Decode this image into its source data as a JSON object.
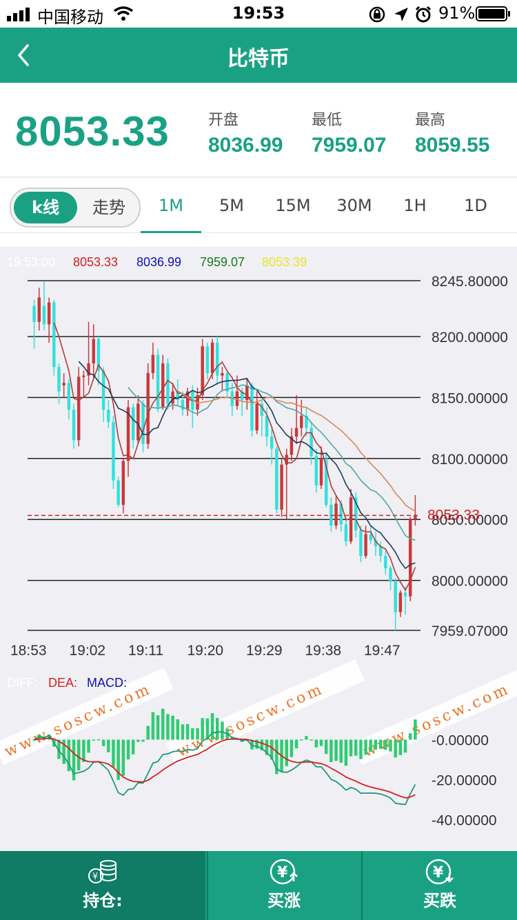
{
  "status_bar": {
    "carrier": "中国移动",
    "time": "19:53",
    "battery": "91%",
    "icons": [
      "signal-icon",
      "wifi-icon",
      "orientation-lock-icon",
      "location-icon",
      "alarm-icon",
      "battery-icon"
    ]
  },
  "nav": {
    "title": "比特币",
    "back_icon": "chevron-left-icon"
  },
  "price": {
    "current": "8053.33",
    "open_label": "开盘",
    "open": "8036.99",
    "low_label": "最低",
    "low": "7959.07",
    "high_label": "最高",
    "high": "8059.55"
  },
  "tabs": {
    "kline": "k线",
    "trend": "走势",
    "periods": [
      "1M",
      "5M",
      "15M",
      "30M",
      "1H",
      "1D"
    ],
    "active_period": "1M"
  },
  "colors": {
    "accent": "#1aa184",
    "up": "#c9393a",
    "down": "#33e0dc",
    "macd_bar": "#2ecc71"
  },
  "chart_data": [
    {
      "type": "candlestick",
      "info_line": {
        "time": "19:53:00",
        "v1": "8053.33",
        "v2": "8036.99",
        "v3": "7959.07",
        "v4": "8053.39"
      },
      "y_labels": [
        "8245.80000",
        "8200.00000",
        "8150.00000",
        "8100.00000",
        "8050.00000",
        "8000.00000",
        "7959.07000"
      ],
      "y_ticks": [
        8245.8,
        8200,
        8150,
        8100,
        8050,
        8000,
        7959.07
      ],
      "ylim": [
        7959.07,
        8245.8
      ],
      "x_labels": [
        "18:53",
        "19:02",
        "19:11",
        "19:20",
        "19:29",
        "19:38",
        "19:47"
      ],
      "current_price_label": "8053.33",
      "current_price": 8053.33,
      "candles": [
        [
          8225,
          8212,
          8230,
          8190
        ],
        [
          8212,
          8232,
          8240,
          8205
        ],
        [
          8225,
          8210,
          8245,
          8205
        ],
        [
          8210,
          8228,
          8232,
          8195
        ],
        [
          8228,
          8175,
          8230,
          8168
        ],
        [
          8175,
          8155,
          8178,
          8145
        ],
        [
          8160,
          8162,
          8170,
          8150
        ],
        [
          8162,
          8140,
          8165,
          8132
        ],
        [
          8140,
          8115,
          8145,
          8108
        ],
        [
          8115,
          8167,
          8175,
          8110
        ],
        [
          8167,
          8168,
          8172,
          8150
        ],
        [
          8168,
          8178,
          8212,
          8160
        ],
        [
          8178,
          8198,
          8210,
          8165
        ],
        [
          8198,
          8172,
          8200,
          8160
        ],
        [
          8172,
          8140,
          8175,
          8130
        ],
        [
          8140,
          8130,
          8148,
          8125
        ],
        [
          8130,
          8082,
          8135,
          8075
        ],
        [
          8082,
          8062,
          8085,
          8060
        ],
        [
          8062,
          8098,
          8100,
          8055
        ],
        [
          8098,
          8142,
          8148,
          8085
        ],
        [
          8142,
          8115,
          8145,
          8108
        ],
        [
          8115,
          8145,
          8152,
          8112
        ],
        [
          8145,
          8112,
          8148,
          8105
        ],
        [
          8112,
          8170,
          8178,
          8108
        ],
        [
          8170,
          8185,
          8195,
          8165
        ],
        [
          8185,
          8142,
          8190,
          8138
        ],
        [
          8142,
          8178,
          8185,
          8140
        ],
        [
          8178,
          8145,
          8182,
          8140
        ],
        [
          8145,
          8155,
          8162,
          8140
        ],
        [
          8155,
          8148,
          8165,
          8143
        ],
        [
          8148,
          8140,
          8155,
          8135
        ],
        [
          8140,
          8155,
          8158,
          8135
        ],
        [
          8155,
          8140,
          8160,
          8125
        ],
        [
          8140,
          8152,
          8158,
          8135
        ],
        [
          8152,
          8192,
          8198,
          8148
        ],
        [
          8192,
          8170,
          8195,
          8165
        ],
        [
          8170,
          8195,
          8198,
          8165
        ],
        [
          8195,
          8168,
          8200,
          8160
        ],
        [
          8168,
          8170,
          8175,
          8155
        ],
        [
          8170,
          8155,
          8172,
          8150
        ],
        [
          8155,
          8143,
          8162,
          8135
        ],
        [
          8143,
          8155,
          8168,
          8140
        ],
        [
          8155,
          8148,
          8158,
          8135
        ],
        [
          8148,
          8160,
          8165,
          8140
        ],
        [
          8160,
          8123,
          8162,
          8118
        ],
        [
          8123,
          8145,
          8155,
          8120
        ],
        [
          8145,
          8135,
          8148,
          8118
        ],
        [
          8135,
          8118,
          8142,
          8110
        ],
        [
          8118,
          8108,
          8125,
          8095
        ],
        [
          8108,
          8058,
          8110,
          8055
        ],
        [
          8058,
          8095,
          8100,
          8052
        ],
        [
          8095,
          8103,
          8108,
          8050
        ],
        [
          8103,
          8118,
          8125,
          8098
        ],
        [
          8118,
          8125,
          8152,
          8112
        ],
        [
          8125,
          8135,
          8148,
          8118
        ],
        [
          8135,
          8125,
          8142,
          8118
        ],
        [
          8125,
          8102,
          8130,
          8095
        ],
        [
          8102,
          8078,
          8108,
          8072
        ],
        [
          8078,
          8100,
          8110,
          8075
        ],
        [
          8100,
          8062,
          8105,
          8060
        ],
        [
          8062,
          8045,
          8068,
          8040
        ],
        [
          8045,
          8063,
          8070,
          8042
        ],
        [
          8063,
          8046,
          8066,
          8040
        ],
        [
          8046,
          8032,
          8052,
          8028
        ],
        [
          8032,
          8068,
          8075,
          8030
        ],
        [
          8068,
          8041,
          8072,
          8035
        ],
        [
          8041,
          8020,
          8045,
          8015
        ],
        [
          8020,
          8038,
          8045,
          8018
        ],
        [
          8038,
          8033,
          8045,
          8030
        ],
        [
          8033,
          8028,
          8040,
          8020
        ],
        [
          8028,
          8020,
          8032,
          8015
        ],
        [
          8020,
          8010,
          8025,
          8005
        ],
        [
          8010,
          7999,
          8012,
          7992
        ],
        [
          7999,
          7974,
          8002,
          7959
        ],
        [
          7974,
          7990,
          7992,
          7970
        ],
        [
          7990,
          7987,
          7995,
          7972
        ],
        [
          7987,
          8050,
          8052,
          7983
        ],
        [
          8050,
          8053.33,
          8070,
          8045
        ]
      ]
    },
    {
      "type": "bar",
      "title_labels": {
        "diff": "DIFF:",
        "dea": "DEA:",
        "macd": "MACD:"
      },
      "y_labels": [
        "-0.00000",
        "-20.00000",
        "-40.00000"
      ],
      "y_ticks": [
        0,
        -20,
        -40
      ],
      "ylim": [
        -45,
        5
      ]
    }
  ],
  "bottom_bar": {
    "hold_label": "持仓:",
    "buy_up_label": "买涨",
    "buy_down_label": "买跌",
    "hold_icon": "coins-icon",
    "up_icon": "yen-up-icon",
    "down_icon": "yen-down-icon"
  }
}
